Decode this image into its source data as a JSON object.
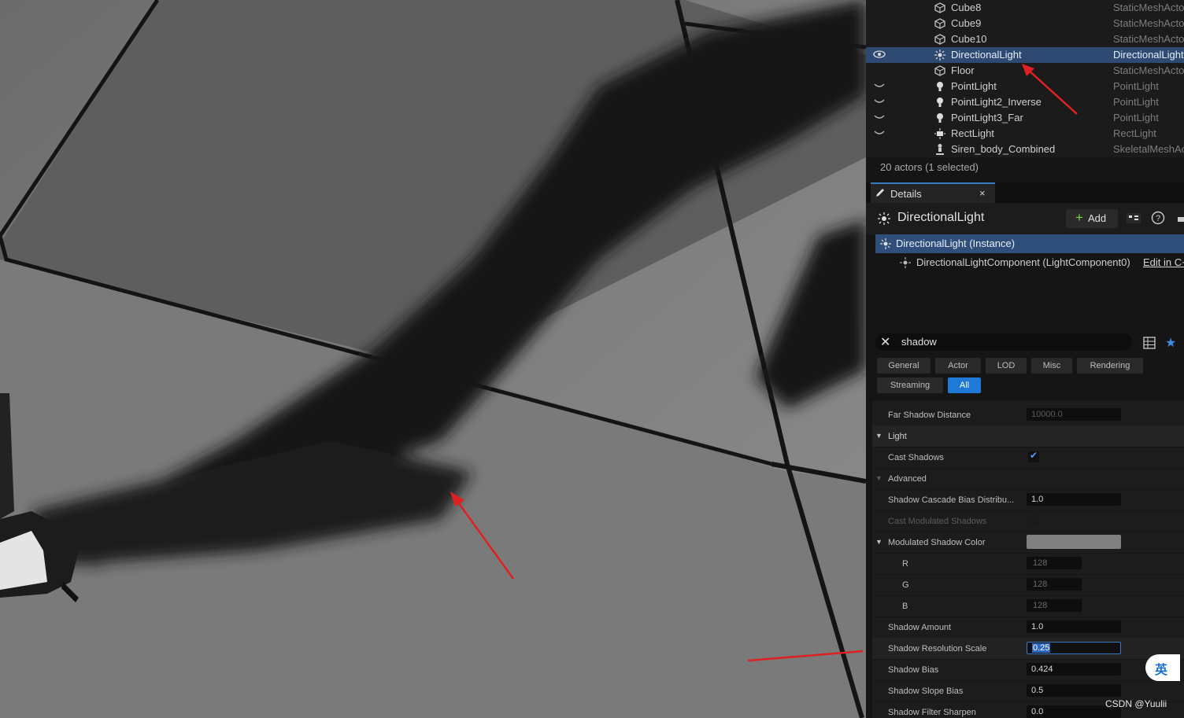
{
  "outliner": {
    "rows": [
      {
        "name": "Cube8",
        "type": "StaticMeshActo",
        "icon": "static-mesh-icon"
      },
      {
        "name": "Cube9",
        "type": "StaticMeshActo",
        "icon": "static-mesh-icon"
      },
      {
        "name": "Cube10",
        "type": "StaticMeshActo",
        "icon": "static-mesh-icon"
      },
      {
        "name": "DirectionalLight",
        "type": "DirectionalLight",
        "icon": "directional-light-icon"
      },
      {
        "name": "Floor",
        "type": "StaticMeshActo",
        "icon": "static-mesh-icon"
      },
      {
        "name": "PointLight",
        "type": "PointLight",
        "icon": "point-light-icon"
      },
      {
        "name": "PointLight2_Inverse",
        "type": "PointLight",
        "icon": "point-light-icon"
      },
      {
        "name": "PointLight3_Far",
        "type": "PointLight",
        "icon": "point-light-icon"
      },
      {
        "name": "RectLight",
        "type": "RectLight",
        "icon": "rect-light-icon"
      },
      {
        "name": "Siren_body_Combined",
        "type": "SkeletalMeshAc",
        "icon": "skeletal-mesh-icon"
      }
    ],
    "actors_count": "20 actors (1 selected)"
  },
  "details": {
    "tab_label": "Details",
    "actor_title": "DirectionalLight",
    "add_label": "Add",
    "instance_label": "DirectionalLight (Instance)",
    "component_label": "DirectionalLightComponent (LightComponent0)",
    "edit_label": "Edit in C+",
    "search_value": "shadow",
    "filters": [
      "General",
      "Actor",
      "LOD",
      "Misc",
      "Rendering",
      "Streaming",
      "All"
    ],
    "active_filter": "All"
  },
  "properties": {
    "far_shadow_distance": {
      "label": "Far Shadow Distance",
      "value": "10000.0"
    },
    "light_category": "Light",
    "cast_shadows": {
      "label": "Cast Shadows",
      "checked": true
    },
    "advanced": "Advanced",
    "cascade_bias": {
      "label": "Shadow Cascade Bias Distribu...",
      "value": "1.0"
    },
    "cast_modulated": {
      "label": "Cast Modulated Shadows"
    },
    "modulated_color": {
      "label": "Modulated Shadow Color",
      "color": "#808080"
    },
    "r": {
      "label": "R",
      "value": "128"
    },
    "g": {
      "label": "G",
      "value": "128"
    },
    "b": {
      "label": "B",
      "value": "128"
    },
    "shadow_amount": {
      "label": "Shadow Amount",
      "value": "1.0"
    },
    "shadow_res_scale": {
      "label": "Shadow Resolution Scale",
      "value": "0.25"
    },
    "shadow_bias": {
      "label": "Shadow Bias",
      "value": "0.424"
    },
    "shadow_slope_bias": {
      "label": "Shadow Slope Bias",
      "value": "0.5"
    },
    "shadow_filter_sharpen": {
      "label": "Shadow Filter Sharpen",
      "value": "0.0"
    }
  },
  "overlay": {
    "ime_label": "英",
    "watermark": "CSDN @Yuulii"
  },
  "colors": {
    "selection": "#2e4a73",
    "accent": "#1e7ad6",
    "arrow": "#e02020"
  }
}
